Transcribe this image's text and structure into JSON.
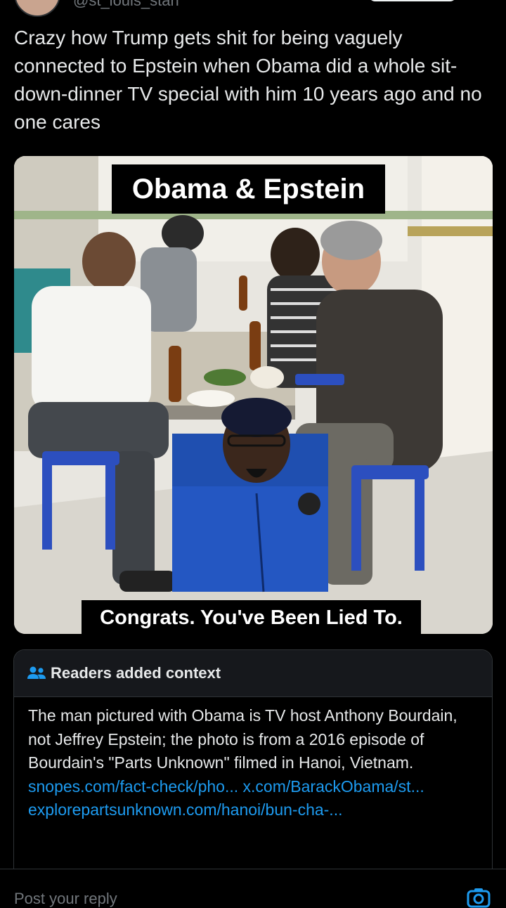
{
  "author": {
    "handle": "@st_louis_stan"
  },
  "tweet": {
    "text": "Crazy how Trump gets shit for being vaguely connected to Epstein when Obama did a whole sit-down-dinner TV special with him 10 years ago and no one cares"
  },
  "media": {
    "caption_top": "Obama & Epstein",
    "caption_bottom": "Congrats. You've Been Lied To."
  },
  "community_note": {
    "icon": "people-icon",
    "title": "Readers added context",
    "body": "The man pictured with Obama is TV host Anthony Bourdain, not Jeffrey Epstein; the photo is from a 2016 episode of Bourdain's \"Parts Unknown\" filmed in Hanoi, Vietnam.",
    "links": [
      "snopes.com/fact-check/pho...",
      "x.com/BarackObama/st...",
      "explorepartsunknown.com/hanoi/bun-cha-..."
    ],
    "accent_color": "#1d9bf0"
  },
  "reply": {
    "placeholder": "Post your reply",
    "icon": "camera-icon"
  }
}
